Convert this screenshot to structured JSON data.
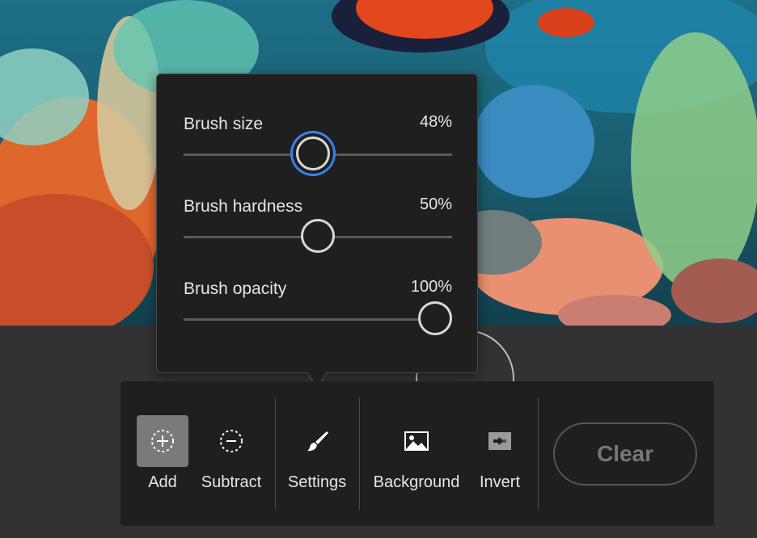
{
  "settings_popover": {
    "sliders": [
      {
        "label": "Brush size",
        "value_text": "48%",
        "value": 48
      },
      {
        "label": "Brush hardness",
        "value_text": "50%",
        "value": 50
      },
      {
        "label": "Brush opacity",
        "value_text": "100%",
        "value": 100
      }
    ]
  },
  "toolbar": {
    "add_label": "Add",
    "subtract_label": "Subtract",
    "settings_label": "Settings",
    "background_label": "Background",
    "invert_label": "Invert",
    "clear_label": "Clear"
  },
  "colors": {
    "accent_focus": "#3b82e6",
    "panel": "#1f1f1f",
    "active_tool": "#7a7a7a"
  }
}
